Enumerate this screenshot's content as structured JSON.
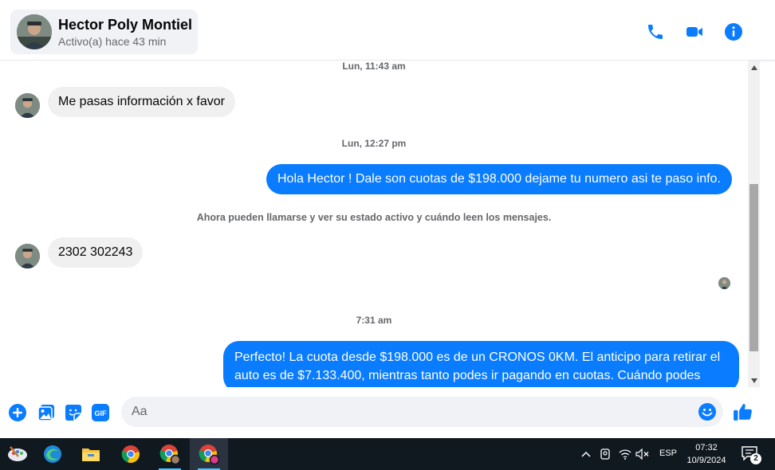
{
  "header": {
    "contact_name": "Hector Poly Montiel",
    "contact_status": "Activo(a) hace 43 min",
    "icons": [
      "phone-icon",
      "video-icon",
      "info-icon"
    ],
    "accent_color": "#0a7cff"
  },
  "conversation": {
    "timestamp_1": "Lun, 11:43 am",
    "msg_in_1": "Me pasas información x favor",
    "timestamp_2": "Lun, 12:27 pm",
    "msg_out_1": "Hola Hector ! Dale son cuotas de $198.000 dejame tu numero asi te paso info.",
    "notice": "Ahora pueden llamarse y ver su estado activo y cuándo leen los mensajes.",
    "msg_in_2": "2302 302243",
    "timestamp_3": "7:31 am",
    "msg_out_2": "Perfecto! La cuota desde $198.000 es de un CRONOS 0KM. El anticipo para retirar el auto es de $7.133.400, mientras tanto podes ir pagando en cuotas. Cuándo podes"
  },
  "composer": {
    "placeholder": "Aa",
    "icons": [
      "plus-icon",
      "image-icon",
      "sticker-icon",
      "gif-icon",
      "emoji-icon",
      "like-icon"
    ],
    "gif_label": "GIF"
  },
  "taskbar": {
    "apps": [
      "paint-app",
      "edge-app",
      "file-explorer-app",
      "chrome-app",
      "chrome-profile-app",
      "chrome-profile-active-app"
    ],
    "language": "ESP",
    "time": "07:32",
    "date": "10/9/2024",
    "notification_count": "2"
  }
}
